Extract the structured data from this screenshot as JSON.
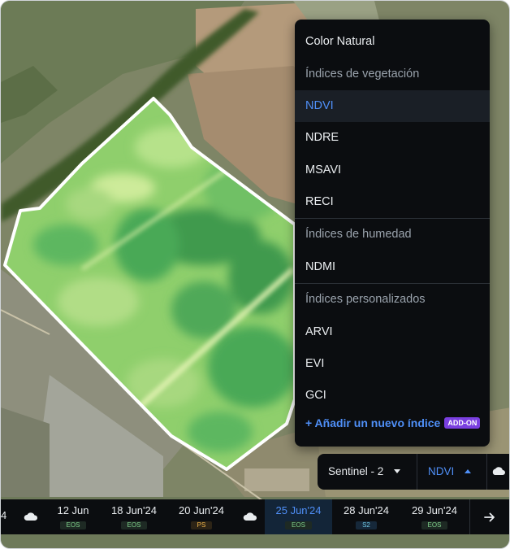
{
  "menu": {
    "items": [
      {
        "label": "Color Natural",
        "kind": "option"
      },
      {
        "label": "Índices de vegetación",
        "kind": "header"
      },
      {
        "label": "NDVI",
        "kind": "option",
        "active": true
      },
      {
        "label": "NDRE",
        "kind": "option"
      },
      {
        "label": "MSAVI",
        "kind": "option"
      },
      {
        "label": "RECI",
        "kind": "option"
      },
      {
        "label": "Índices de humedad",
        "kind": "header"
      },
      {
        "label": "NDMI",
        "kind": "option"
      },
      {
        "label": "Índices personalizados",
        "kind": "header"
      },
      {
        "label": "ARVI",
        "kind": "option"
      },
      {
        "label": "EVI",
        "kind": "option"
      },
      {
        "label": "GCI",
        "kind": "option"
      }
    ],
    "add_label": "+ Añadir un nuevo índice",
    "add_badge": "ADD-ON"
  },
  "selectors": {
    "satellite": "Sentinel - 2",
    "index": "NDVI"
  },
  "timeline": {
    "edge_label": "4",
    "dates": [
      {
        "date": "12 Jun",
        "badge": "EOS",
        "badge_type": "eos"
      },
      {
        "date": "18 Jun'24",
        "badge": "EOS",
        "badge_type": "eos"
      },
      {
        "date": "20 Jun'24",
        "badge": "PS",
        "badge_type": "ps"
      },
      {
        "date": "25 Jun'24",
        "badge": "EOS",
        "badge_type": "eos",
        "active": true
      },
      {
        "date": "28 Jun'24",
        "badge": "S2",
        "badge_type": "s2"
      },
      {
        "date": "29 Jun'24",
        "badge": "EOS",
        "badge_type": "eos"
      }
    ]
  },
  "colors": {
    "accent": "#4f8ff7",
    "panel": "#0b0d10",
    "addon": "#7a3fe0",
    "field_green": "#8fcf6c"
  },
  "icons": {
    "cloud": "cloud-icon",
    "next": "arrow-right-icon",
    "layers": "cloud-sun-icon"
  }
}
